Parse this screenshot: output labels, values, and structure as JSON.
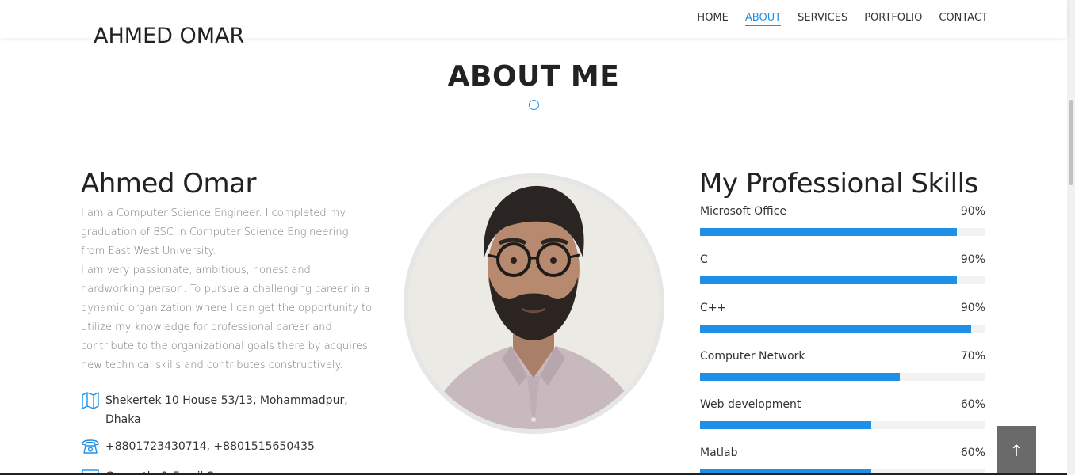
{
  "header": {
    "brand": "AHMED OMAR",
    "nav": [
      {
        "label": "HOME",
        "active": false
      },
      {
        "label": "ABOUT",
        "active": true
      },
      {
        "label": "SERVICES",
        "active": false
      },
      {
        "label": "PORTFOLIO",
        "active": false
      },
      {
        "label": "CONTACT",
        "active": false
      }
    ]
  },
  "about": {
    "section_title": "ABOUT ME",
    "name": "Ahmed Omar",
    "bio_1": "I am a Computer Science Engineer. I completed my graduation of BSC in Computer Science Engineering from East West University.",
    "bio_2": "I am very passionate, ambitious, honest and hardworking person. To pursue a challenging career in a dynamic organization where I can get the opportunity to utilize my knowledge for professional career and contribute to the organizational goals there by acquires new technical skills and contributes constructively.",
    "address": "Shekertek 10 House 53/13, Mohammadpur, Dhaka",
    "phone": "+8801723430714, +8801515650435",
    "email": "Currently & Email Ss..."
  },
  "skills": {
    "title": "My Professional Skills",
    "items": [
      {
        "label": "Microsoft Office",
        "percent_text": "90%",
        "fill": 0.9
      },
      {
        "label": "C",
        "percent_text": "90%",
        "fill": 0.9
      },
      {
        "label": "C++",
        "percent_text": "90%",
        "fill": 0.95
      },
      {
        "label": "Computer Network",
        "percent_text": "70%",
        "fill": 0.7
      },
      {
        "label": "Web development",
        "percent_text": "60%",
        "fill": 0.6
      },
      {
        "label": "Matlab",
        "percent_text": "60%",
        "fill": 0.6
      }
    ]
  },
  "ui": {
    "accent_color": "#1e90e8",
    "back_to_top_icon": "arrow-up-icon",
    "back_to_top_glyph": "↑"
  }
}
